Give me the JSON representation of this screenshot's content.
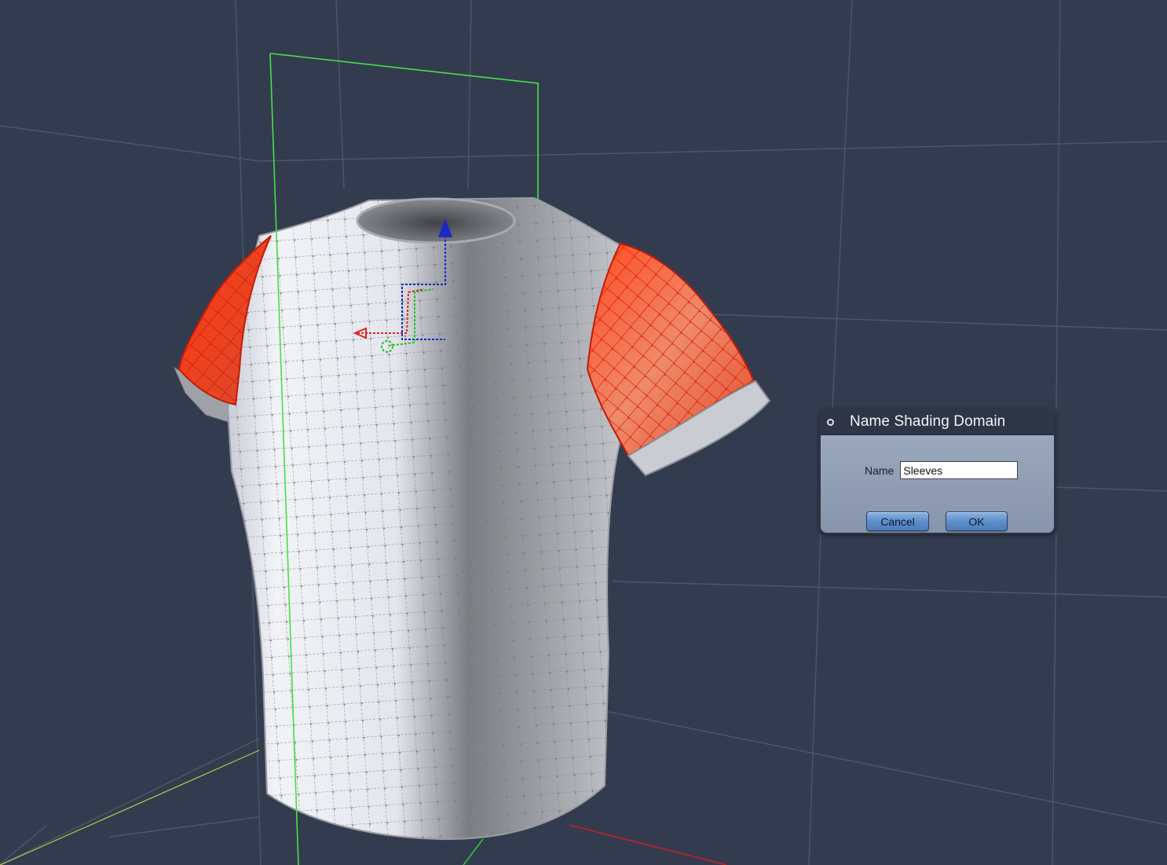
{
  "dialog": {
    "title": "Name Shading Domain",
    "name_label": "Name",
    "name_value": "Sleeves",
    "cancel_label": "Cancel",
    "ok_label": "OK"
  },
  "scene": {
    "object": "t-shirt mesh",
    "selected_region": "sleeves",
    "colors": {
      "background": "#333c4f",
      "selection": "#ff2a12",
      "bounding_box": "#46e046",
      "axis_x": "#e02020",
      "axis_y": "#20c020",
      "axis_z": "#1a28c8"
    }
  }
}
